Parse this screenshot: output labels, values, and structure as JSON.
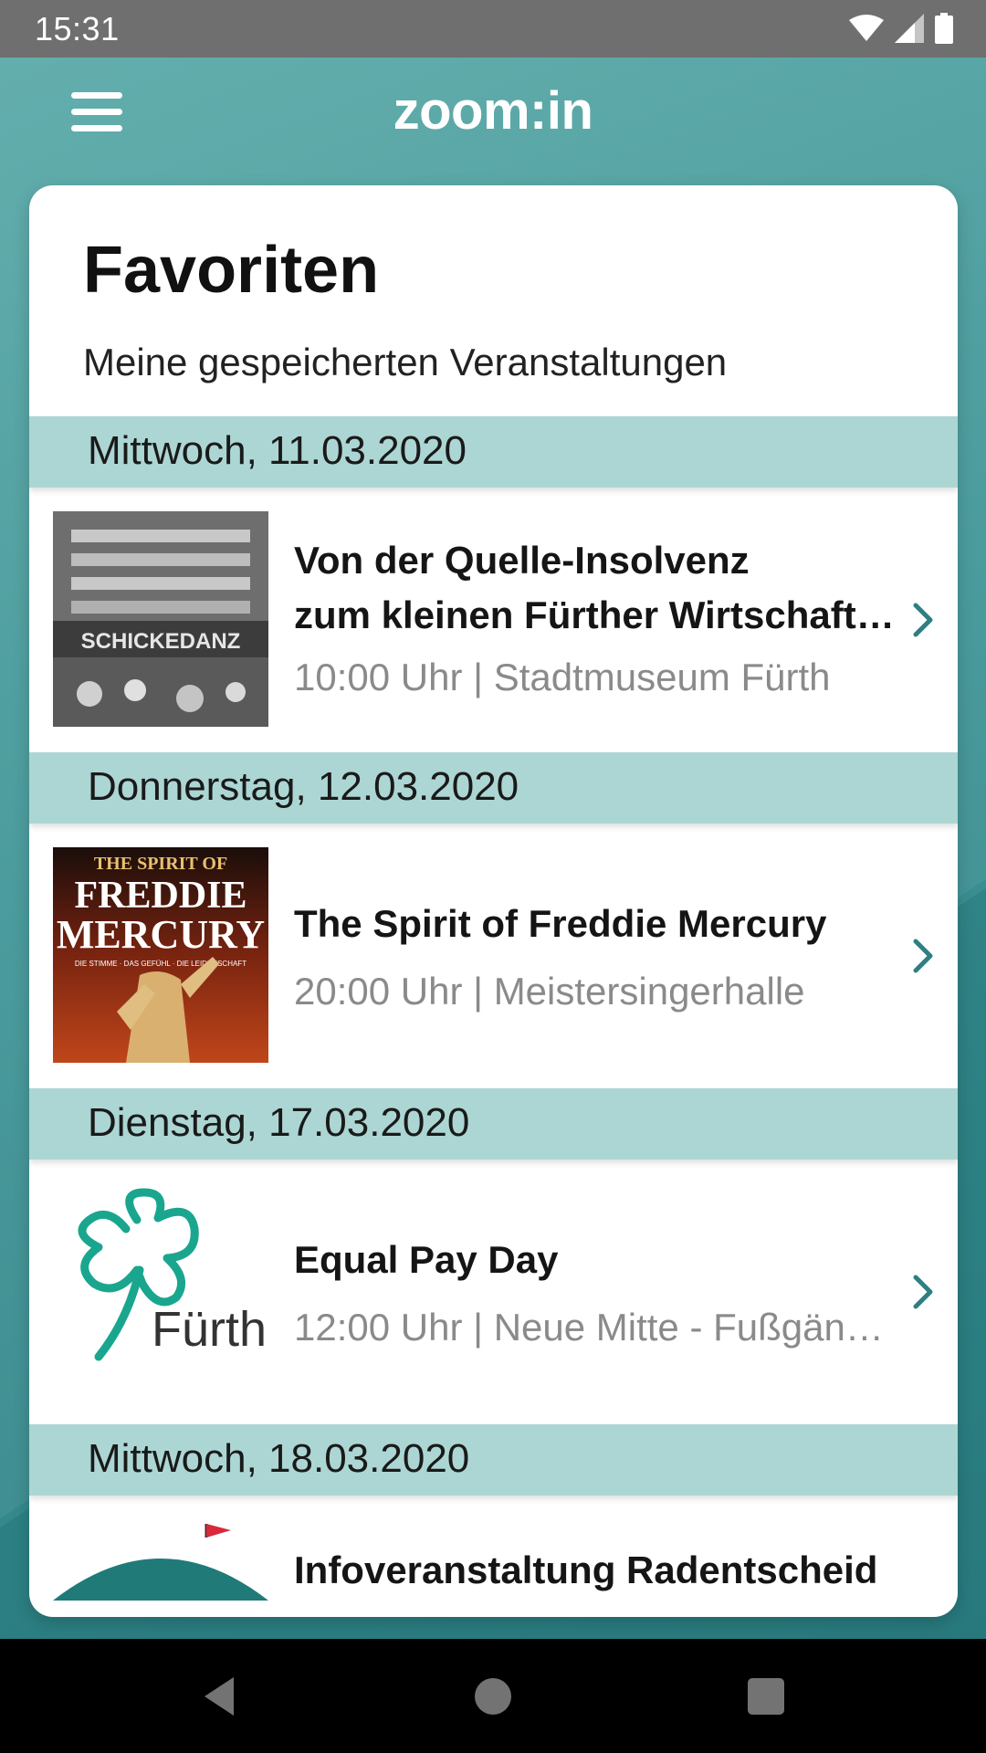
{
  "status_bar": {
    "time": "15:31",
    "icons": [
      "wifi-icon",
      "signal-icon",
      "battery-icon"
    ]
  },
  "app_bar": {
    "title": "zoom:in",
    "menu_icon": "hamburger-menu-icon"
  },
  "page": {
    "title": "Favoriten",
    "subtitle": "Meine gespeicherten Veranstaltungen"
  },
  "sections": [
    {
      "date": "Mittwoch, 11.03.2020",
      "event": {
        "title_line1": "Von der Quelle-Insolvenz",
        "title_line2": "zum kleinen Fürther Wirtschaft…",
        "meta": "10:00 Uhr | Stadtmuseum Fürth",
        "image_text": "SCHICKEDANZ"
      }
    },
    {
      "date": "Donnerstag, 12.03.2020",
      "event": {
        "title": "The Spirit of Freddie Mercury",
        "meta": "20:00 Uhr | Meistersingerhalle",
        "image_text_1": "THE SPIRIT OF",
        "image_text_2": "FREDDIE",
        "image_text_3": "MERCURY",
        "image_text_4": "DIE STIMME · DAS GEFÜHL · DIE LEIDENSCHAFT"
      }
    },
    {
      "date": "Dienstag, 17.03.2020",
      "event": {
        "title": "Equal Pay Day",
        "meta": "12:00 Uhr | Neue Mitte - Fußgän…",
        "image_text": "Fürth"
      }
    },
    {
      "date": "Mittwoch, 18.03.2020",
      "event": {
        "title": "Infoveranstaltung Radentscheid"
      }
    }
  ],
  "nav_bar": {
    "buttons": [
      "back-icon",
      "home-icon",
      "recents-icon"
    ]
  },
  "colors": {
    "accent_teal": "#3f9597",
    "date_header": "#acd6d3",
    "chevron": "#2e7f82",
    "meta_text": "#8a8a8a"
  }
}
